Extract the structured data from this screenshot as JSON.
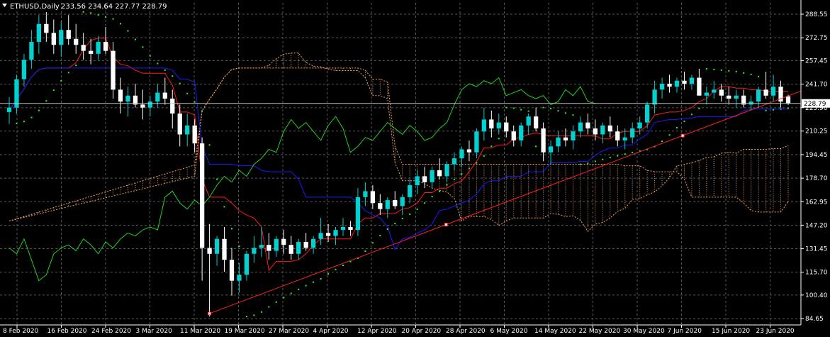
{
  "header": {
    "symbol": "ETHUSD,Daily",
    "ohlc": "233.56 234.64 227.77 228.79"
  },
  "colors": {
    "background": "#000000",
    "grid": "#5a5a5a",
    "bull": "#00d2d2",
    "bear": "#ffffff",
    "tenkan": "#ff1a1a",
    "kijun": "#1a1aff",
    "chikou": "#22d022",
    "sar": "#22ff22",
    "cloud": "#f0a060",
    "trendline": "#ff2020",
    "price_label_bg": "#ffffff",
    "price_label_text": "#000000"
  },
  "chart_data": {
    "type": "candlestick",
    "yticks": [
      "288.55",
      "272.75",
      "257.45",
      "241.70",
      "225.90",
      "210.25",
      "194.45",
      "178.70",
      "162.95",
      "147.20",
      "131.45",
      "115.70",
      "100.40",
      "84.65"
    ],
    "ytick_values": [
      288.55,
      272.75,
      257.45,
      241.7,
      225.9,
      210.25,
      194.45,
      178.7,
      162.95,
      147.2,
      131.45,
      115.7,
      100.4,
      84.65
    ],
    "ylim": [
      84.65,
      292
    ],
    "last_price": "228.79",
    "last_price_value": 228.79,
    "xticks": [
      "8 Feb 2020",
      "16 Feb 2020",
      "24 Feb 2020",
      "3 Mar 2020",
      "11 Mar 2020",
      "19 Mar 2020",
      "27 Mar 2020",
      "4 Apr 2020",
      "12 Apr 2020",
      "20 Apr 2020",
      "28 Apr 2020",
      "6 May 2020",
      "14 May 2020",
      "22 May 2020",
      "30 May 2020",
      "7 Jun 2020",
      "15 Jun 2020",
      "23 Jun 2020"
    ],
    "candles": [
      [
        223,
        233,
        215,
        226
      ],
      [
        226,
        248,
        222,
        245
      ],
      [
        245,
        262,
        240,
        258
      ],
      [
        258,
        278,
        252,
        270
      ],
      [
        270,
        288,
        262,
        282
      ],
      [
        282,
        290,
        270,
        276
      ],
      [
        276,
        285,
        262,
        268
      ],
      [
        268,
        284,
        260,
        278
      ],
      [
        278,
        288,
        268,
        272
      ],
      [
        272,
        282,
        262,
        268
      ],
      [
        268,
        276,
        258,
        264
      ],
      [
        264,
        272,
        255,
        262
      ],
      [
        262,
        274,
        258,
        270
      ],
      [
        270,
        280,
        262,
        264
      ],
      [
        264,
        270,
        232,
        238
      ],
      [
        238,
        246,
        222,
        230
      ],
      [
        230,
        240,
        220,
        234
      ],
      [
        234,
        242,
        226,
        228
      ],
      [
        228,
        238,
        218,
        226
      ],
      [
        226,
        234,
        220,
        230
      ],
      [
        230,
        242,
        226,
        236
      ],
      [
        236,
        246,
        228,
        232
      ],
      [
        232,
        238,
        212,
        222
      ],
      [
        222,
        228,
        200,
        208
      ],
      [
        208,
        222,
        200,
        214
      ],
      [
        214,
        218,
        196,
        202
      ],
      [
        202,
        206,
        110,
        132
      ],
      [
        132,
        148,
        86,
        128
      ],
      [
        128,
        140,
        120,
        138
      ],
      [
        138,
        146,
        116,
        124
      ],
      [
        124,
        132,
        100,
        110
      ],
      [
        110,
        122,
        102,
        114
      ],
      [
        114,
        130,
        110,
        128
      ],
      [
        128,
        140,
        122,
        132
      ],
      [
        132,
        146,
        126,
        134
      ],
      [
        134,
        142,
        124,
        130
      ],
      [
        130,
        140,
        126,
        138
      ],
      [
        138,
        144,
        128,
        134
      ],
      [
        134,
        140,
        124,
        128
      ],
      [
        128,
        138,
        124,
        136
      ],
      [
        136,
        142,
        130,
        132
      ],
      [
        132,
        140,
        128,
        138
      ],
      [
        138,
        152,
        134,
        142
      ],
      [
        142,
        148,
        136,
        140
      ],
      [
        140,
        146,
        134,
        144
      ],
      [
        144,
        152,
        140,
        146
      ],
      [
        146,
        150,
        140,
        144
      ],
      [
        144,
        172,
        140,
        166
      ],
      [
        166,
        176,
        160,
        170
      ],
      [
        170,
        174,
        158,
        162
      ],
      [
        162,
        168,
        154,
        158
      ],
      [
        158,
        166,
        152,
        164
      ],
      [
        164,
        170,
        158,
        160
      ],
      [
        160,
        168,
        154,
        166
      ],
      [
        166,
        178,
        162,
        174
      ],
      [
        174,
        184,
        168,
        180
      ],
      [
        180,
        186,
        172,
        176
      ],
      [
        176,
        186,
        172,
        184
      ],
      [
        184,
        192,
        178,
        180
      ],
      [
        180,
        190,
        176,
        188
      ],
      [
        188,
        196,
        184,
        192
      ],
      [
        192,
        200,
        186,
        198
      ],
      [
        198,
        204,
        190,
        196
      ],
      [
        196,
        212,
        192,
        210
      ],
      [
        210,
        226,
        204,
        218
      ],
      [
        218,
        224,
        206,
        212
      ],
      [
        212,
        222,
        208,
        216
      ],
      [
        216,
        220,
        206,
        210
      ],
      [
        210,
        214,
        200,
        204
      ],
      [
        204,
        216,
        200,
        214
      ],
      [
        214,
        222,
        208,
        220
      ],
      [
        220,
        226,
        210,
        212
      ],
      [
        212,
        216,
        190,
        196
      ],
      [
        196,
        204,
        188,
        200
      ],
      [
        200,
        210,
        196,
        206
      ],
      [
        206,
        212,
        200,
        204
      ],
      [
        204,
        214,
        198,
        210
      ],
      [
        210,
        220,
        206,
        216
      ],
      [
        216,
        222,
        208,
        212
      ],
      [
        212,
        218,
        204,
        208
      ],
      [
        208,
        216,
        202,
        214
      ],
      [
        214,
        220,
        206,
        210
      ],
      [
        210,
        214,
        200,
        204
      ],
      [
        204,
        212,
        198,
        206
      ],
      [
        206,
        216,
        202,
        212
      ],
      [
        212,
        220,
        208,
        216
      ],
      [
        216,
        230,
        212,
        228
      ],
      [
        228,
        244,
        222,
        238
      ],
      [
        238,
        246,
        232,
        242
      ],
      [
        242,
        248,
        236,
        240
      ],
      [
        240,
        246,
        236,
        244
      ],
      [
        244,
        250,
        238,
        242
      ],
      [
        242,
        248,
        238,
        246
      ],
      [
        246,
        252,
        238,
        234
      ],
      [
        234,
        240,
        228,
        236
      ],
      [
        236,
        244,
        232,
        238
      ],
      [
        238,
        242,
        230,
        234
      ],
      [
        234,
        240,
        228,
        232
      ],
      [
        232,
        238,
        226,
        234
      ],
      [
        234,
        238,
        226,
        228
      ],
      [
        228,
        234,
        224,
        230
      ],
      [
        230,
        240,
        226,
        238
      ],
      [
        238,
        250,
        232,
        234
      ],
      [
        234,
        248,
        230,
        240
      ],
      [
        240,
        244,
        226,
        230
      ],
      [
        233.56,
        234.64,
        227.77,
        228.79
      ]
    ]
  }
}
